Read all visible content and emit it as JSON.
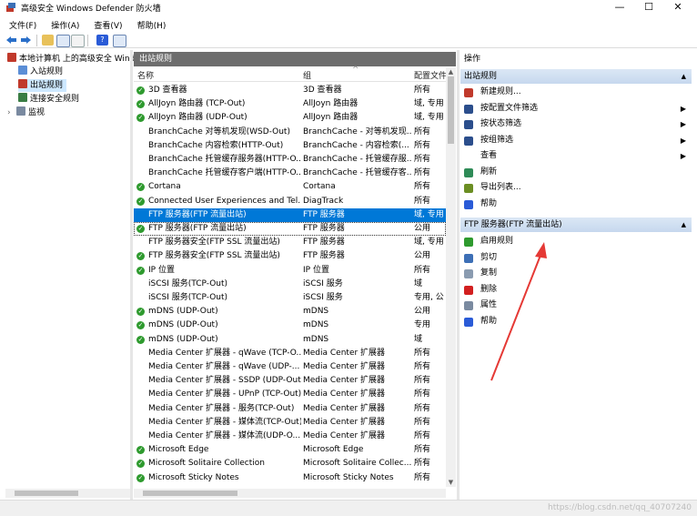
{
  "window": {
    "title": "高级安全 Windows Defender 防火墙",
    "minimize": "—",
    "maximize": "☐",
    "close": "✕"
  },
  "menu": [
    "文件(F)",
    "操作(A)",
    "查看(V)",
    "帮助(H)"
  ],
  "tree": {
    "root": "本地计算机 上的高级安全 Windo",
    "items": [
      "入站规则",
      "出站规则",
      "连接安全规则",
      "监视"
    ],
    "expander": "›"
  },
  "list": {
    "header": "出站规则",
    "columns": {
      "name": "名称",
      "group": "组",
      "profile": "配置文件"
    },
    "rows": [
      {
        "name": "3D 查看器",
        "group": "3D 查看器",
        "profile": "所有",
        "enabled": true
      },
      {
        "name": "AllJoyn 路由器 (TCP-Out)",
        "group": "AllJoyn 路由器",
        "profile": "域, 专用",
        "enabled": true
      },
      {
        "name": "AllJoyn 路由器 (UDP-Out)",
        "group": "AllJoyn 路由器",
        "profile": "域, 专用",
        "enabled": true
      },
      {
        "name": "BranchCache 对等机发现(WSD-Out)",
        "group": "BranchCache - 对等机发现...",
        "profile": "所有",
        "enabled": false
      },
      {
        "name": "BranchCache 内容检索(HTTP-Out)",
        "group": "BranchCache - 内容检索(...",
        "profile": "所有",
        "enabled": false
      },
      {
        "name": "BranchCache 托管缓存服务器(HTTP-O...",
        "group": "BranchCache - 托管缓存服...",
        "profile": "所有",
        "enabled": false
      },
      {
        "name": "BranchCache 托管缓存客户端(HTTP-O...",
        "group": "BranchCache - 托管缓存客...",
        "profile": "所有",
        "enabled": false
      },
      {
        "name": "Cortana",
        "group": "Cortana",
        "profile": "所有",
        "enabled": true
      },
      {
        "name": "Connected User Experiences and Tel...",
        "group": "DiagTrack",
        "profile": "所有",
        "enabled": true
      },
      {
        "name": "FTP 服务器(FTP 流量出站)",
        "group": "FTP 服务器",
        "profile": "域, 专用",
        "enabled": false,
        "selected": true
      },
      {
        "name": "FTP 服务器(FTP 流量出站)",
        "group": "FTP 服务器",
        "profile": "公用",
        "enabled": true,
        "focus": true
      },
      {
        "name": "FTP 服务器安全(FTP SSL 流量出站)",
        "group": "FTP 服务器",
        "profile": "域, 专用",
        "enabled": false
      },
      {
        "name": "FTP 服务器安全(FTP SSL 流量出站)",
        "group": "FTP 服务器",
        "profile": "公用",
        "enabled": true
      },
      {
        "name": "IP 位置",
        "group": "IP 位置",
        "profile": "所有",
        "enabled": true
      },
      {
        "name": "iSCSI 服务(TCP-Out)",
        "group": "iSCSI 服务",
        "profile": "域",
        "enabled": false
      },
      {
        "name": "iSCSI 服务(TCP-Out)",
        "group": "iSCSI 服务",
        "profile": "专用, 公",
        "enabled": false
      },
      {
        "name": "mDNS (UDP-Out)",
        "group": "mDNS",
        "profile": "公用",
        "enabled": true
      },
      {
        "name": "mDNS (UDP-Out)",
        "group": "mDNS",
        "profile": "专用",
        "enabled": true
      },
      {
        "name": "mDNS (UDP-Out)",
        "group": "mDNS",
        "profile": "域",
        "enabled": true
      },
      {
        "name": "Media Center 扩展器 - qWave (TCP-O...",
        "group": "Media Center 扩展器",
        "profile": "所有",
        "enabled": false
      },
      {
        "name": "Media Center 扩展器 - qWave (UDP-...",
        "group": "Media Center 扩展器",
        "profile": "所有",
        "enabled": false
      },
      {
        "name": "Media Center 扩展器 - SSDP (UDP-Out)",
        "group": "Media Center 扩展器",
        "profile": "所有",
        "enabled": false
      },
      {
        "name": "Media Center 扩展器 - UPnP (TCP-Out)",
        "group": "Media Center 扩展器",
        "profile": "所有",
        "enabled": false
      },
      {
        "name": "Media Center 扩展器 - 服务(TCP-Out)",
        "group": "Media Center 扩展器",
        "profile": "所有",
        "enabled": false
      },
      {
        "name": "Media Center 扩展器 - 媒体流(TCP-Out)",
        "group": "Media Center 扩展器",
        "profile": "所有",
        "enabled": false
      },
      {
        "name": "Media Center 扩展器 - 媒体流(UDP-O...",
        "group": "Media Center 扩展器",
        "profile": "所有",
        "enabled": false
      },
      {
        "name": "Microsoft Edge",
        "group": "Microsoft Edge",
        "profile": "所有",
        "enabled": true
      },
      {
        "name": "Microsoft Solitaire Collection",
        "group": "Microsoft Solitaire Collec...",
        "profile": "所有",
        "enabled": true
      },
      {
        "name": "Microsoft Sticky Notes",
        "group": "Microsoft Sticky Notes",
        "profile": "所有",
        "enabled": true
      }
    ]
  },
  "actions": {
    "title": "操作",
    "section1": {
      "title": "出站规则",
      "items": [
        {
          "label": "新建规则...",
          "icon": "new-rule-icon",
          "color": "#c0392b",
          "submenu": false
        },
        {
          "label": "按配置文件筛选",
          "icon": "filter-icon",
          "color": "#2b4e8c",
          "submenu": true
        },
        {
          "label": "按状态筛选",
          "icon": "filter-icon",
          "color": "#2b4e8c",
          "submenu": true
        },
        {
          "label": "按组筛选",
          "icon": "filter-icon",
          "color": "#2b4e8c",
          "submenu": true
        },
        {
          "label": "查看",
          "icon": "",
          "color": "",
          "submenu": true
        },
        {
          "label": "刷新",
          "icon": "refresh-icon",
          "color": "#2e8b57",
          "submenu": false
        },
        {
          "label": "导出列表...",
          "icon": "export-icon",
          "color": "#6b8e23",
          "submenu": false
        },
        {
          "label": "帮助",
          "icon": "help-icon",
          "color": "#2a5bd7",
          "submenu": false
        }
      ]
    },
    "section2": {
      "title": "FTP 服务器(FTP 流量出站)",
      "items": [
        {
          "label": "启用规则",
          "icon": "enable-icon",
          "color": "#2e9a2e"
        },
        {
          "label": "剪切",
          "icon": "cut-icon",
          "color": "#3d6fb6"
        },
        {
          "label": "复制",
          "icon": "copy-icon",
          "color": "#8a9bb0"
        },
        {
          "label": "删除",
          "icon": "delete-icon",
          "color": "#d21f1f"
        },
        {
          "label": "属性",
          "icon": "properties-icon",
          "color": "#7a8aa0"
        },
        {
          "label": "帮助",
          "icon": "help-icon",
          "color": "#2a5bd7"
        }
      ]
    }
  },
  "status": {
    "watermark": "https://blog.csdn.net/qq_40707240"
  },
  "colors": {
    "selection": "#0078d7",
    "header": "#6d6d6d",
    "section": "#c6d8ee",
    "annotation_arrow": "#e53935"
  }
}
